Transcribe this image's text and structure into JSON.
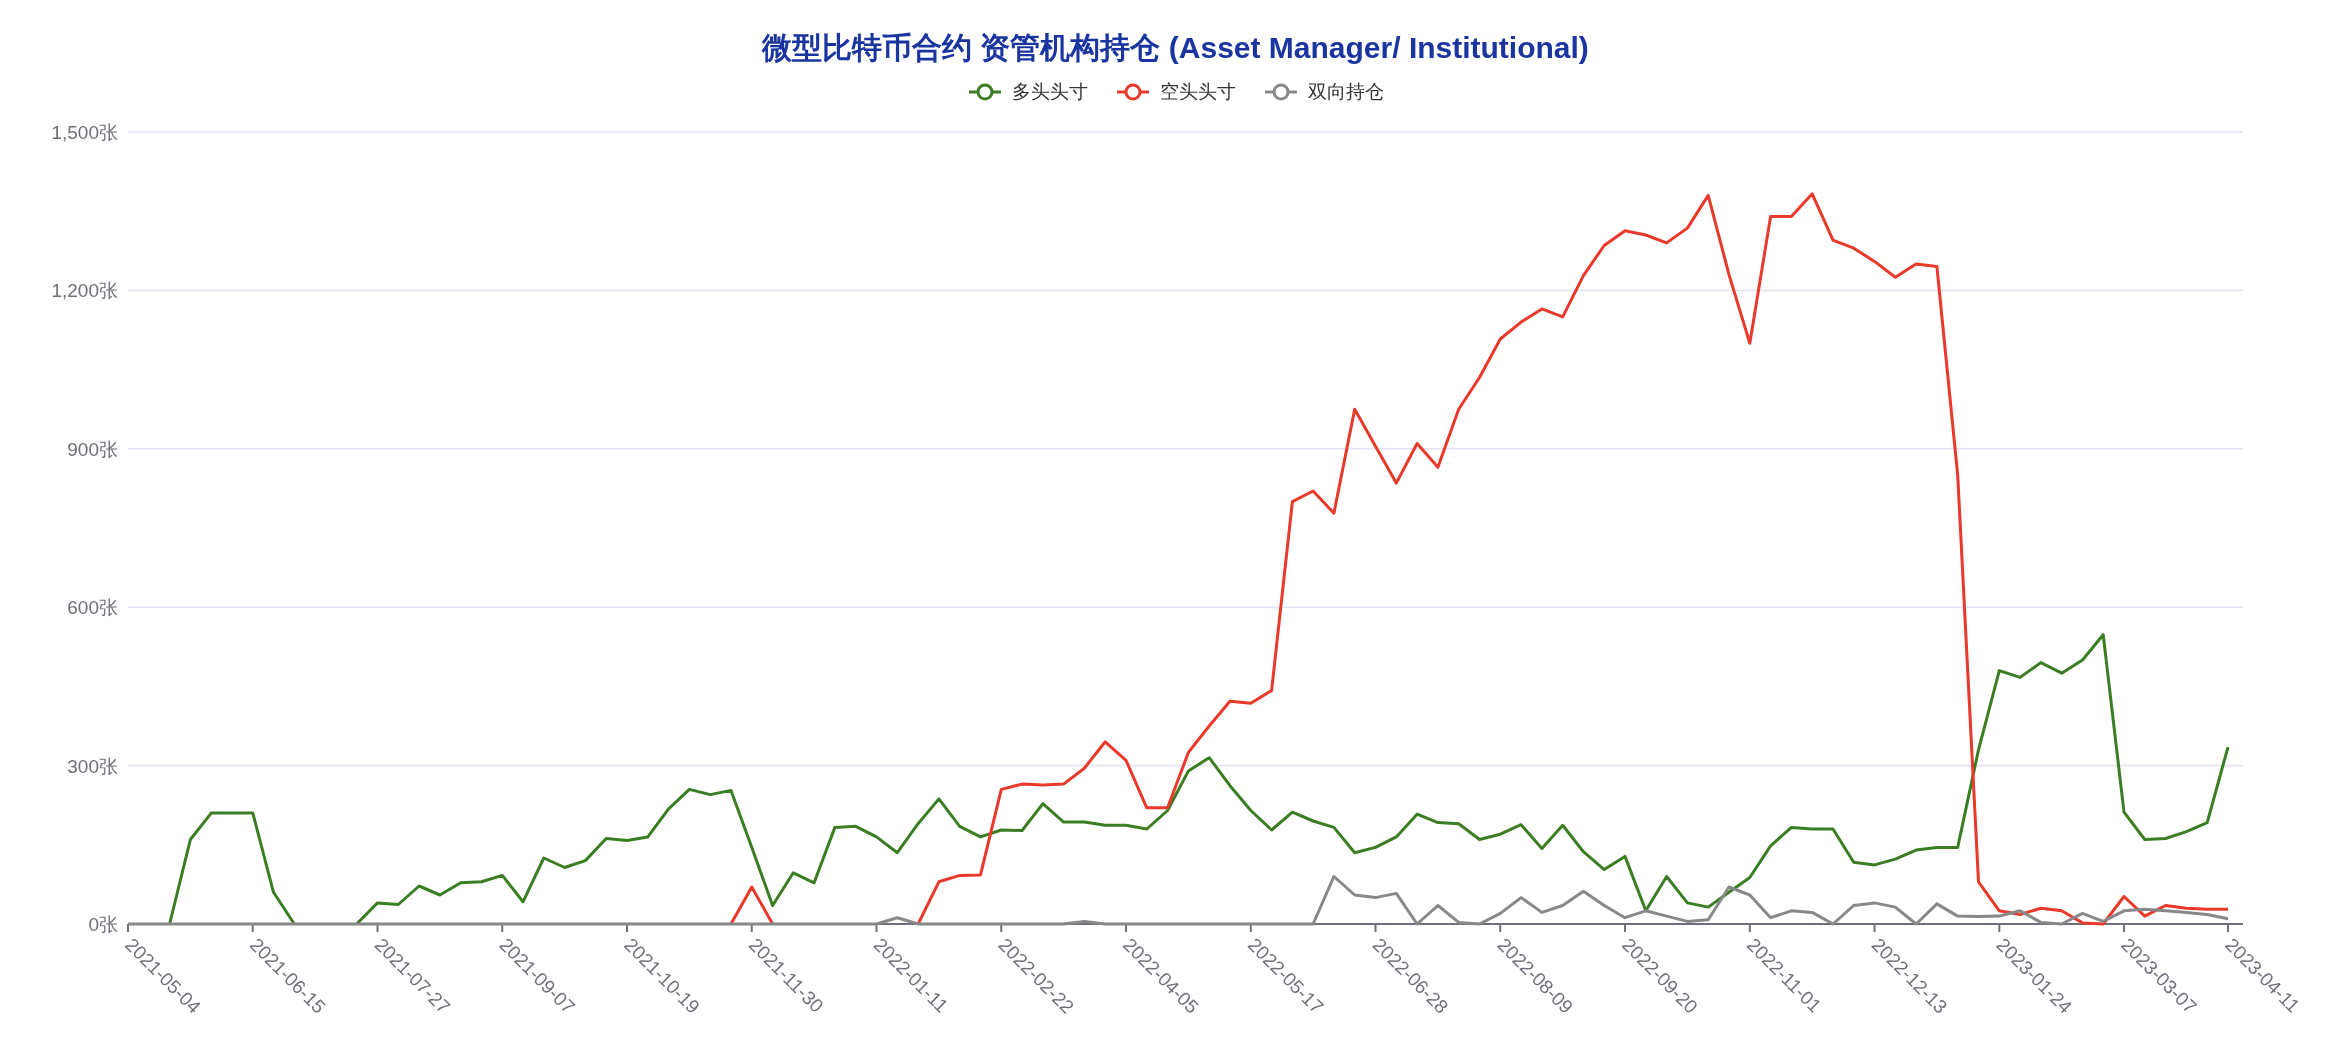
{
  "chart": {
    "chart_data": {
      "type": "line",
      "title": "微型比特币合约 资管机构持仓 (Asset Manager/ Institutional)",
      "grid": true,
      "categories": [
        "2021-05-04",
        null,
        null,
        null,
        null,
        null,
        "2021-06-15",
        null,
        null,
        null,
        null,
        null,
        "2021-07-27",
        null,
        null,
        null,
        null,
        null,
        "2021-09-07",
        null,
        null,
        null,
        null,
        null,
        "2021-10-19",
        null,
        null,
        null,
        null,
        null,
        "2021-11-30",
        null,
        null,
        null,
        null,
        null,
        "2022-01-11",
        null,
        null,
        null,
        null,
        null,
        "2022-02-22",
        null,
        null,
        null,
        null,
        null,
        "2022-04-05",
        null,
        null,
        null,
        null,
        null,
        "2022-05-17",
        null,
        null,
        null,
        null,
        null,
        "2022-06-28",
        null,
        null,
        null,
        null,
        null,
        "2022-08-09",
        null,
        null,
        null,
        null,
        null,
        "2022-09-20",
        null,
        null,
        null,
        null,
        null,
        "2022-11-01",
        null,
        null,
        null,
        null,
        null,
        "2022-12-13",
        null,
        null,
        null,
        null,
        null,
        "2023-01-24",
        null,
        null,
        null,
        null,
        null,
        "2023-03-07",
        null,
        null,
        null,
        null,
        "2023-04-11"
      ],
      "yticks": [
        {
          "value": 0,
          "label": "0张"
        },
        {
          "value": 300,
          "label": "300张"
        },
        {
          "value": 600,
          "label": "600张"
        },
        {
          "value": 900,
          "label": "900张"
        },
        {
          "value": 1200,
          "label": "1,200张"
        },
        {
          "value": 1500,
          "label": "1,500张"
        }
      ],
      "ylim": [
        0,
        1500
      ],
      "series": [
        {
          "name": "多头头寸",
          "color": "#3a7d22",
          "values": [
            null,
            null,
            0,
            160,
            210,
            210,
            210,
            60,
            0,
            null,
            null,
            0,
            40,
            37,
            72,
            55,
            78,
            80,
            92,
            42,
            125,
            107,
            120,
            162,
            158,
            165,
            218,
            255,
            245,
            253,
            145,
            35,
            97,
            78,
            183,
            185,
            165,
            135,
            190,
            237,
            185,
            165,
            178,
            177,
            228,
            193,
            193,
            187,
            187,
            180,
            215,
            290,
            315,
            262,
            215,
            178,
            212,
            195,
            183,
            135,
            145,
            165,
            208,
            192,
            190,
            160,
            170,
            188,
            143,
            187,
            137,
            103,
            128,
            25,
            90,
            40,
            32,
            60,
            88,
            148,
            183,
            180,
            180,
            117,
            112,
            123,
            140,
            145,
            145,
            330,
            480,
            467,
            495,
            475,
            500,
            548,
            212,
            160,
            162,
            175,
            192,
            335
          ]
        },
        {
          "name": "空头头寸",
          "color": "#e8392b",
          "values": [
            null,
            null,
            null,
            null,
            null,
            null,
            null,
            null,
            null,
            null,
            null,
            null,
            null,
            null,
            null,
            null,
            null,
            null,
            null,
            null,
            null,
            null,
            null,
            null,
            null,
            null,
            null,
            null,
            null,
            0,
            70,
            0,
            null,
            null,
            null,
            null,
            null,
            null,
            0,
            80,
            92,
            93,
            255,
            265,
            263,
            265,
            295,
            345,
            310,
            220,
            220,
            325,
            375,
            422,
            418,
            442,
            800,
            820,
            778,
            975,
            905,
            835,
            910,
            865,
            975,
            1035,
            1108,
            1140,
            1165,
            1150,
            1228,
            1285,
            1313,
            1305,
            1290,
            1318,
            1380,
            1230,
            1100,
            1340,
            1340,
            1383,
            1295,
            1280,
            1255,
            1225,
            1250,
            1245,
            850,
            80,
            25,
            18,
            30,
            25,
            2,
            0,
            52,
            15,
            35,
            30,
            28,
            28
          ]
        },
        {
          "name": "双向持仓",
          "color": "#888888",
          "values": [
            0,
            0,
            0,
            0,
            0,
            0,
            0,
            0,
            0,
            0,
            0,
            0,
            0,
            0,
            0,
            0,
            0,
            0,
            0,
            0,
            0,
            0,
            0,
            0,
            0,
            0,
            0,
            0,
            0,
            0,
            0,
            0,
            0,
            0,
            0,
            0,
            0,
            12,
            0,
            0,
            0,
            0,
            0,
            0,
            0,
            0,
            5,
            0,
            0,
            0,
            0,
            0,
            0,
            0,
            0,
            0,
            0,
            0,
            90,
            55,
            50,
            58,
            0,
            35,
            3,
            0,
            20,
            50,
            22,
            35,
            62,
            35,
            12,
            25,
            15,
            5,
            8,
            70,
            55,
            12,
            25,
            22,
            0,
            35,
            40,
            32,
            0,
            38,
            15,
            14,
            15,
            25,
            3,
            0,
            20,
            5,
            25,
            28,
            25,
            22,
            18,
            10
          ]
        }
      ]
    }
  }
}
